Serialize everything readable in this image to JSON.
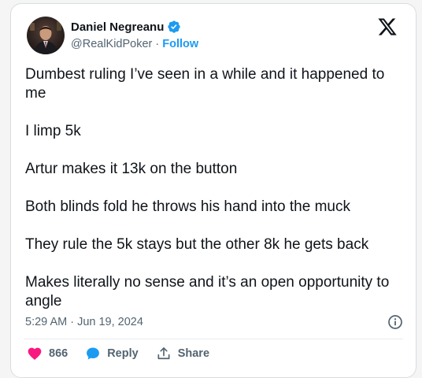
{
  "author": {
    "name": "Daniel Negreanu",
    "handle": "@RealKidPoker",
    "separator": "·",
    "follow_label": "Follow"
  },
  "tweet": {
    "paragraphs": [
      "Dumbest ruling I’ve seen in a while and it happened to me",
      "I limp 5k",
      "Artur makes it 13k on the button",
      "Both blinds fold he throws his hand into the muck",
      "They rule the 5k stays but the other 8k he gets back",
      "Makes literally no sense and it’s an open opportunity to angle"
    ],
    "timestamp": "5:29 AM · Jun 19, 2024"
  },
  "actions": {
    "like_count": "866",
    "reply_label": "Reply",
    "share_label": "Share"
  },
  "colors": {
    "like": "#f91880",
    "reply": "#1d9bf0",
    "follow": "#1d9bf0",
    "verified": "#1d9bf0",
    "muted_text": "#536471"
  },
  "icons": [
    "verified-badge-icon",
    "x-logo-icon",
    "info-icon",
    "heart-icon",
    "reply-bubble-icon",
    "share-icon"
  ]
}
